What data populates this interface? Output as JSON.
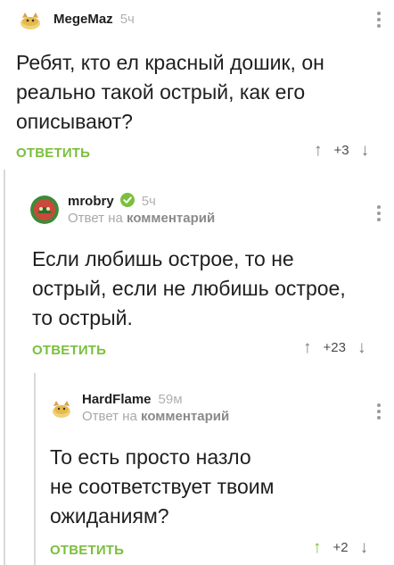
{
  "comments": [
    {
      "username": "MegeMaz",
      "time": "5ч",
      "text_lines": [
        "Ребят, кто ел красный дошик, он",
        "реально такой острый, как его",
        "описывают?"
      ],
      "reply_label": "ОТВЕТИТЬ",
      "rating": "+3",
      "up_icon": "arrow-up-icon",
      "down_icon": "arrow-down-icon"
    },
    {
      "username": "mrobry",
      "time": "5ч",
      "reply_prefix": "Ответ на",
      "reply_target": "комментарий",
      "text_lines": [
        "Если любишь острое, то не",
        "острый, если не любишь острое,",
        "то острый."
      ],
      "reply_label": "ОТВЕТИТЬ",
      "rating": "+23"
    },
    {
      "username": "HardFlame",
      "time": "59м",
      "reply_prefix": "Ответ на",
      "reply_target": "комментарий",
      "text_lines": [
        "То есть просто назло",
        "не соответствует твоим",
        "ожиданиям?"
      ],
      "reply_label": "ОТВЕТИТЬ",
      "rating": "+2"
    }
  ],
  "colors": {
    "accent_green": "#7bbf3c",
    "text": "#1f1f1f",
    "muted": "#b0b0b0",
    "thread_line": "#d9d9d9"
  }
}
